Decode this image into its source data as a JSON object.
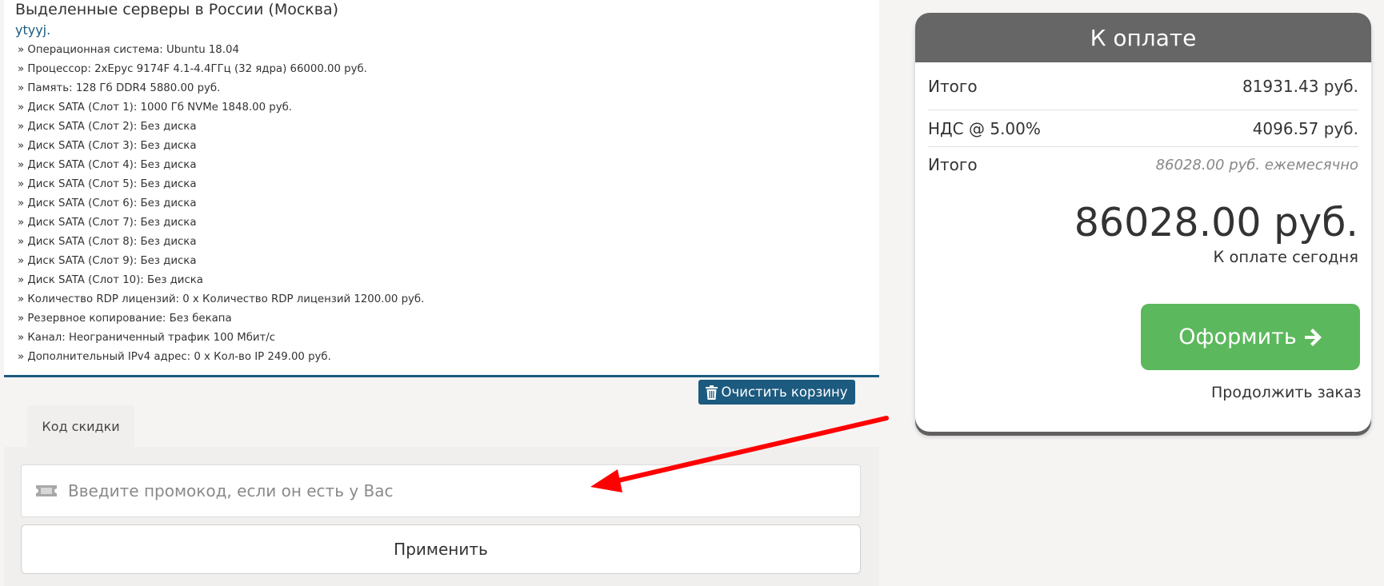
{
  "product": {
    "title": "Выделенные серверы в России (Москва)",
    "host": "ytyyj.",
    "config": [
      "» Операционная система: Ubuntu 18.04",
      "» Процессор: 2xEpyc 9174F 4.1-4.4ГГц (32 ядра) 66000.00 руб.",
      "» Память: 128 Гб DDR4 5880.00 руб.",
      "» Диск SATA (Слот 1): 1000 Гб NVMe 1848.00 руб.",
      "» Диск SATA (Слот 2): Без диска",
      "» Диск SATA (Слот 3): Без диска",
      "» Диск SATA (Слот 4): Без диска",
      "» Диск SATA (Слот 5): Без диска",
      "» Диск SATA (Слот 6): Без диска",
      "» Диск SATA (Слот 7): Без диска",
      "» Диск SATA (Слот 8): Без диска",
      "» Диск SATA (Слот 9): Без диска",
      "» Диск SATA (Слот 10): Без диска",
      "» Количество RDP лицензий: 0 x Количество RDP лицензий 1200.00 руб.",
      "» Резервное копирование: Без бекапа",
      "» Канал: Неограниченный трафик 100 Мбит/c",
      "» Дополнительный IPv4 адрес: 0 x Кол-во IP 249.00 руб."
    ],
    "clear_cart_label": "Очистить корзину"
  },
  "promo": {
    "tab_label": "Код скидки",
    "placeholder": "Введите промокод, если он есть у Вас",
    "value": "",
    "apply_label": "Применить"
  },
  "summary": {
    "header": "К оплате",
    "rows": [
      {
        "label": "Итого",
        "value": "81931.43 руб."
      },
      {
        "label": "НДС @ 5.00%",
        "value": "4096.57 руб."
      },
      {
        "label": "Итого",
        "value": "86028.00 руб. ежемесячно"
      }
    ],
    "total": "86028.00 руб.",
    "total_caption": "К оплате сегодня",
    "checkout_label": "Оформить",
    "continue_label": "Продолжить заказ"
  },
  "icons": {
    "trash": "trash-icon",
    "ticket": "ticket-icon",
    "arrow": "arrow-right-icon"
  },
  "colors": {
    "accent_blue": "#1c5a7f",
    "checkout_green": "#5cb85c",
    "summary_header": "#666666",
    "annotation_red": "#ff0000"
  }
}
